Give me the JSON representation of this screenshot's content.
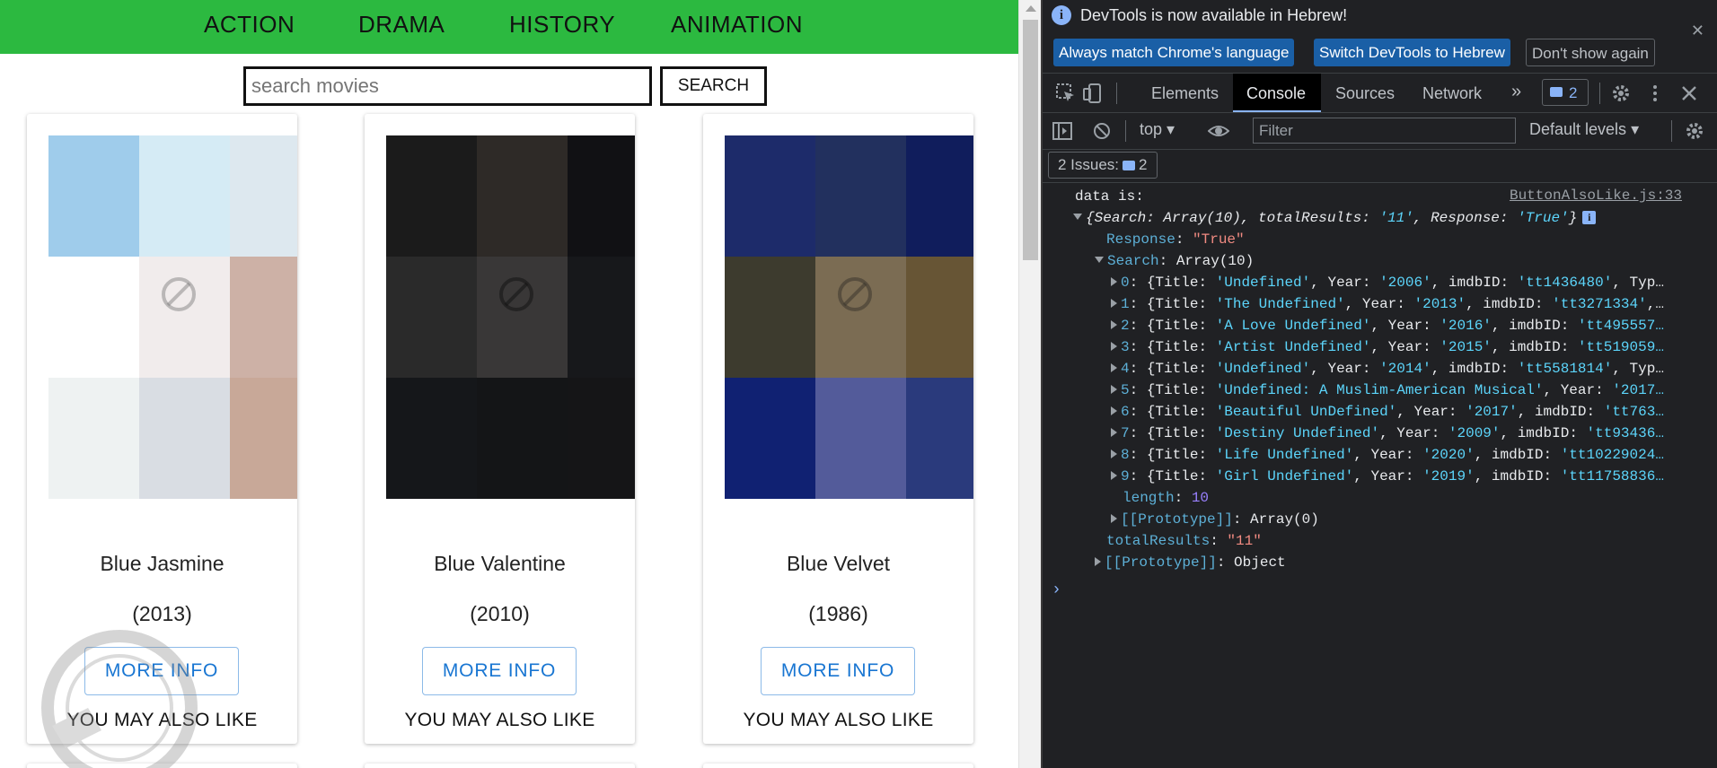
{
  "nav": {
    "items": [
      "ACTION",
      "DRAMA",
      "HISTORY",
      "ANIMATION"
    ]
  },
  "search": {
    "placeholder": "search movies",
    "value": "",
    "button_label": "SEARCH"
  },
  "movies": [
    {
      "title": "Blue Jasmine",
      "year": "(2013)",
      "button": "MORE INFO",
      "also_like": "YOU MAY ALSO LIKE",
      "colors": [
        "#9fcceb",
        "#d5ebf5",
        "#dde8ef",
        "#ffffff",
        "#f1ecec",
        "#cdb1a6",
        "#eef2f2",
        "#d9dde3",
        "#c8a898"
      ]
    },
    {
      "title": "Blue Valentine",
      "year": "(2010)",
      "button": "MORE INFO",
      "also_like": "YOU MAY ALSO LIKE",
      "colors": [
        "#1b1b1b",
        "#2e2a27",
        "#111114",
        "#2a2a2a",
        "#393737",
        "#17181b",
        "#15171a",
        "#141517",
        "#151517"
      ]
    },
    {
      "title": "Blue Velvet",
      "year": "(1986)",
      "button": "MORE INFO",
      "also_like": "YOU MAY ALSO LIKE",
      "colors": [
        "#1d2b6a",
        "#22305e",
        "#101d5c",
        "#3d3b2e",
        "#7b6c53",
        "#675535",
        "#102172",
        "#535b9a",
        "#2a3a7c"
      ]
    }
  ],
  "devtools": {
    "infobar": {
      "message": "DevTools is now available in Hebrew!",
      "buttons": [
        "Always match Chrome's language",
        "Switch DevTools to Hebrew",
        "Don't show again"
      ]
    },
    "tabs": [
      "Elements",
      "Console",
      "Sources",
      "Network"
    ],
    "active_tab": "Console",
    "message_count": "2",
    "context": "top",
    "filter_placeholder": "Filter",
    "levels": "Default levels",
    "issues": {
      "label": "2 Issues:",
      "count": "2"
    },
    "log": {
      "label": "data is:",
      "source": "ButtonAlsoLike.js:33",
      "summary": {
        "search": "Array(10)",
        "totalResults": "'11'",
        "response": "'True'"
      },
      "response": "\"True\"",
      "search_header": "Array(10)",
      "rows": [
        {
          "index": "0",
          "title": "'Undefined'",
          "year": "'2006'",
          "imdb": "'tt1436480'",
          "tail": ", Typ…"
        },
        {
          "index": "1",
          "title": "'The Undefined'",
          "year": "'2013'",
          "imdb": "'tt3271334'",
          "tail": ",…"
        },
        {
          "index": "2",
          "title": "'A Love Undefined'",
          "year": "'2016'",
          "imdb": "'tt495557…",
          "tail": ""
        },
        {
          "index": "3",
          "title": "'Artist Undefined'",
          "year": "'2015'",
          "imdb": "'tt519059…",
          "tail": ""
        },
        {
          "index": "4",
          "title": "'Undefined'",
          "year": "'2014'",
          "imdb": "'tt5581814'",
          "tail": ", Typ…"
        },
        {
          "index": "5",
          "title": "'Undefined: A Muslim-American Musical'",
          "year": "'2017…",
          "imdb": "",
          "tail": ""
        },
        {
          "index": "6",
          "title": "'Beautiful UnDefined'",
          "year": "'2017'",
          "imdb": "'tt763…",
          "tail": ""
        },
        {
          "index": "7",
          "title": "'Destiny Undefined'",
          "year": "'2009'",
          "imdb": "'tt93436…",
          "tail": ""
        },
        {
          "index": "8",
          "title": "'Life Undefined'",
          "year": "'2020'",
          "imdb": "'tt10229024…",
          "tail": ""
        },
        {
          "index": "9",
          "title": "'Girl Undefined'",
          "year": "'2019'",
          "imdb": "'tt11758836…",
          "tail": ""
        }
      ],
      "length": "10",
      "array_prototype": "Array(0)",
      "total_results": "\"11\"",
      "object_prototype": "Object"
    }
  }
}
